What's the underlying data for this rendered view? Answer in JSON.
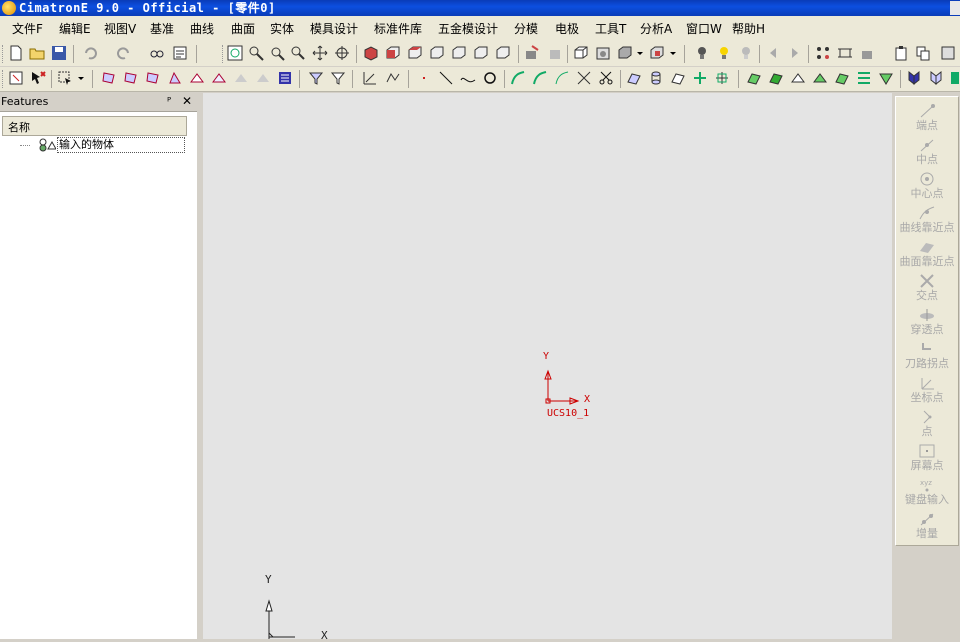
{
  "window": {
    "title": "CimatronE 9.0 - Official - [零件0]"
  },
  "menu": [
    "文件F",
    "编辑E",
    "视图V",
    "基准",
    "曲线",
    "曲面",
    "实体",
    "模具设计",
    "标准件库",
    "五金模设计",
    "分模",
    "电极",
    "工具T",
    "分析A",
    "窗口W",
    "帮助H"
  ],
  "panel": {
    "title": "Features",
    "pin": "ᴾ",
    "close": "✕",
    "column": "名称",
    "item": "输入的物体"
  },
  "viewport": {
    "ucs_main": {
      "x": "X",
      "y": "Y",
      "name": "UCS10_1"
    },
    "ucs_corner": {
      "x": "X",
      "y": "Y"
    }
  },
  "right_panel": [
    "端点",
    "中点",
    "中心点",
    "曲线靠近点",
    "曲面靠近点",
    "交点",
    "穿透点",
    "刀路拐点",
    "坐标点",
    "点",
    "屏幕点",
    "键盘输入",
    "增量"
  ],
  "colors": {
    "titlebar": "#0c4fe0",
    "ucs": "#cc0000",
    "viewport": "#e4e4e4",
    "disabled_text": "#a8a8a8"
  }
}
